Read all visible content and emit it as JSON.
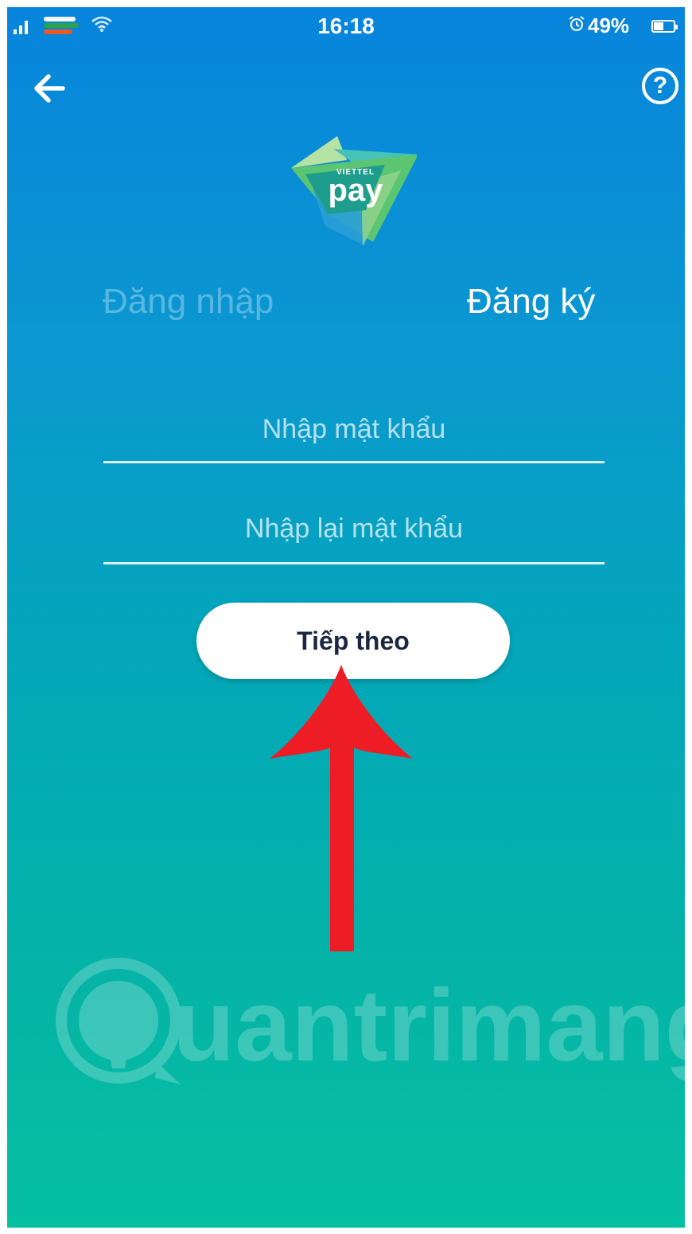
{
  "status_bar": {
    "time": "16:18",
    "battery_percent": "49%",
    "battery_level": 0.49,
    "icons": [
      "signal-icon",
      "carrier-icon",
      "wifi-icon",
      "alarm-icon",
      "battery-icon"
    ]
  },
  "header": {
    "back_icon": "arrow-left-icon",
    "help_icon": "help-circle-icon",
    "help_symbol": "?"
  },
  "logo": {
    "brand": "VIETTEL",
    "name": "pay"
  },
  "tabs": {
    "login": "Đăng nhập",
    "register": "Đăng ký",
    "active": "register"
  },
  "form": {
    "password_placeholder": "Nhập mật khẩu",
    "confirm_password_placeholder": "Nhập lại mật khẩu",
    "submit_label": "Tiếp theo"
  },
  "annotation": {
    "arrow_color": "#ee1c25"
  },
  "watermark": {
    "text": "uantrimang"
  },
  "colors": {
    "gradient_top": "#0784dc",
    "gradient_bottom": "#06c0a2",
    "button_bg": "#ffffff",
    "button_text": "#1b2740"
  }
}
